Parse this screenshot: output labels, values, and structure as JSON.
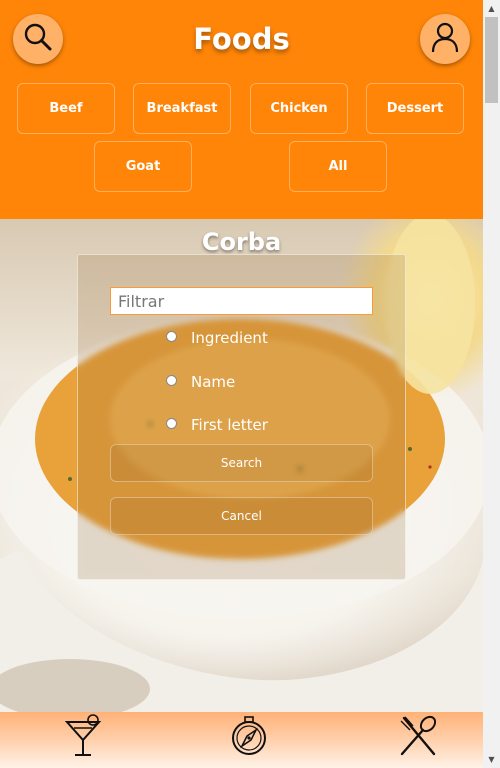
{
  "header": {
    "title": "Foods",
    "search_icon": "search-icon",
    "profile_icon": "user-icon"
  },
  "categories": [
    {
      "label": "Beef"
    },
    {
      "label": "Breakfast"
    },
    {
      "label": "Chicken"
    },
    {
      "label": "Dessert"
    },
    {
      "label": "Goat"
    },
    {
      "label": "All"
    }
  ],
  "hero": {
    "dish_title": "Corba"
  },
  "search_panel": {
    "filter_placeholder": "Filtrar",
    "filter_value": "",
    "options": [
      {
        "label": "Ingredient",
        "checked": false
      },
      {
        "label": "Name",
        "checked": false
      },
      {
        "label": "First letter",
        "checked": false
      }
    ],
    "search_label": "Search",
    "cancel_label": "Cancel"
  },
  "bottom_nav": {
    "items": [
      {
        "icon": "cocktail-icon"
      },
      {
        "icon": "compass-icon"
      },
      {
        "icon": "fork-spoon-icon"
      }
    ]
  },
  "colors": {
    "header_bg": "#ff8508",
    "round_button_bg": "#ffb168",
    "input_border": "#ff9933"
  }
}
